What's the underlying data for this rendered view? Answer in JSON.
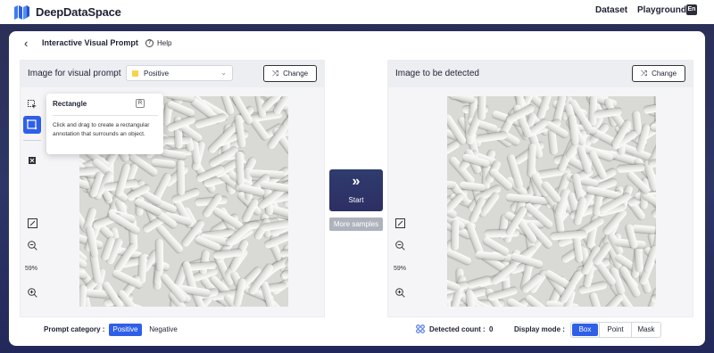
{
  "nav": {
    "brand": "DeepDataSpace",
    "links": [
      "Dataset",
      "Playground"
    ],
    "lang_icon": "En"
  },
  "header": {
    "title": "Interactive Visual Prompt",
    "help_label": "Help"
  },
  "left_panel": {
    "title": "Image for visual prompt",
    "select_value": "Positive",
    "change_label": "Change",
    "zoom": "59%",
    "prompt_category_label": "Prompt category :",
    "categories": [
      "Positive",
      "Negative"
    ]
  },
  "tooltip": {
    "title": "Rectangle",
    "shortcut": "R",
    "description": "Click and drag to create a rectangular annotation that surrounds an object."
  },
  "center": {
    "start_label": "Start",
    "more_label": "More samples"
  },
  "right_panel": {
    "title": "Image to be detected",
    "change_label": "Change",
    "zoom": "59%",
    "detected_label": "Detected count :",
    "detected_count": "0",
    "display_mode_label": "Display mode :",
    "modes": [
      "Box",
      "Point",
      "Mask"
    ]
  },
  "colors": {
    "accent": "#2f5fe8",
    "backdrop": "#2a2f57",
    "positive_swatch": "#f6d44a"
  },
  "icons": {
    "back": "chevron-left-icon",
    "help": "help-circle-icon",
    "shuffle": "shuffle-icon",
    "select_tool": "pointer-select-icon",
    "rect_tool": "rectangle-icon",
    "delete_tool": "delete-icon",
    "fit": "fit-screen-icon",
    "zoom_out": "zoom-out-icon",
    "zoom_in": "zoom-in-icon",
    "start": "double-chevron-right-icon",
    "detected": "grid-dots-icon"
  }
}
